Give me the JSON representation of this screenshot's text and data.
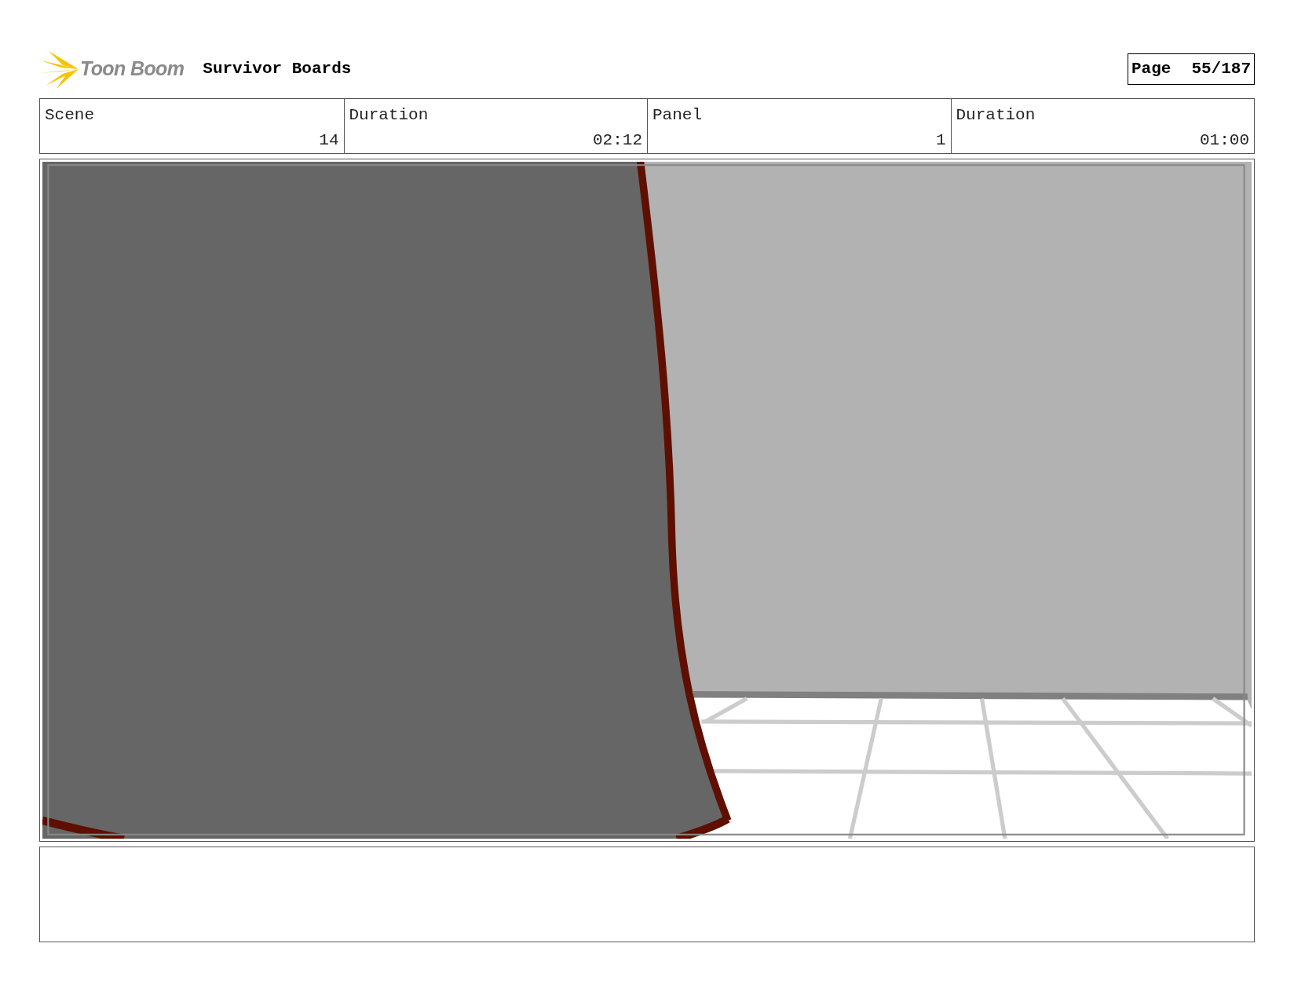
{
  "header": {
    "logo_text": "Toon Boom",
    "project": "Survivor Boards",
    "page_label": "Page",
    "page_number": "55/187"
  },
  "info_table": {
    "columns": [
      "Scene",
      "Duration",
      "Panel",
      "Duration"
    ],
    "rows": [
      [
        "14",
        "02:12",
        "1",
        "01:00"
      ]
    ]
  }
}
